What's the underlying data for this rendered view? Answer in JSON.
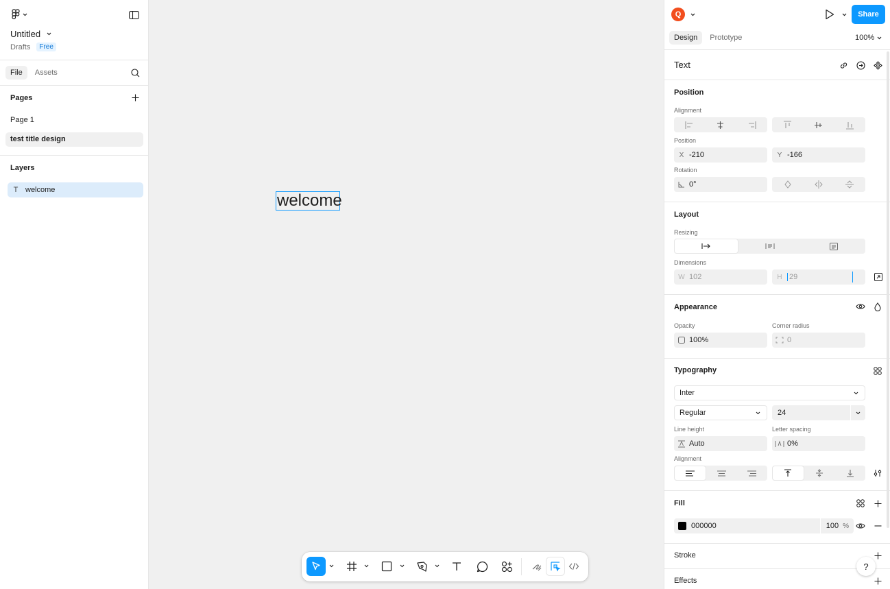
{
  "file": {
    "title": "Untitled",
    "location": "Drafts",
    "plan": "Free"
  },
  "left_tabs": {
    "file": "File",
    "assets": "Assets"
  },
  "pages": {
    "title": "Pages",
    "items": [
      "Page 1",
      "test  title design"
    ]
  },
  "layers": {
    "title": "Layers",
    "items": [
      {
        "type_icon": "T",
        "name": "welcome"
      }
    ]
  },
  "canvas": {
    "text_content": "welcome"
  },
  "header": {
    "avatar_initial": "Q",
    "share_label": "Share",
    "tabs": [
      "Design",
      "Prototype"
    ],
    "zoom": "100%"
  },
  "selection": {
    "type": "Text"
  },
  "position": {
    "title": "Position",
    "alignment_label": "Alignment",
    "position_label": "Position",
    "x_prefix": "X",
    "x_value": "-210",
    "y_prefix": "Y",
    "y_value": "-166",
    "rotation_label": "Rotation",
    "rotation_value": "0°"
  },
  "layout": {
    "title": "Layout",
    "resizing_label": "Resizing",
    "dimensions_label": "Dimensions",
    "w_prefix": "W",
    "w_value": "102",
    "h_prefix": "H",
    "h_value": "29"
  },
  "appearance": {
    "title": "Appearance",
    "opacity_label": "Opacity",
    "opacity_value": "100%",
    "radius_label": "Corner radius",
    "radius_value": "0"
  },
  "typography": {
    "title": "Typography",
    "font_family": "Inter",
    "font_style": "Regular",
    "font_size": "24",
    "line_height_label": "Line height",
    "line_height_value": "Auto",
    "letter_spacing_label": "Letter spacing",
    "letter_spacing_value": "0%",
    "alignment_label": "Alignment"
  },
  "fill": {
    "title": "Fill",
    "hex": "000000",
    "opacity": "100",
    "percent": "%",
    "swatch_color": "#000000"
  },
  "stroke": {
    "title": "Stroke"
  },
  "effects": {
    "title": "Effects"
  },
  "help": "?",
  "colors": {
    "accent": "#0d99ff",
    "avatar": "#f24e1e",
    "selection": "#0d99ff"
  }
}
